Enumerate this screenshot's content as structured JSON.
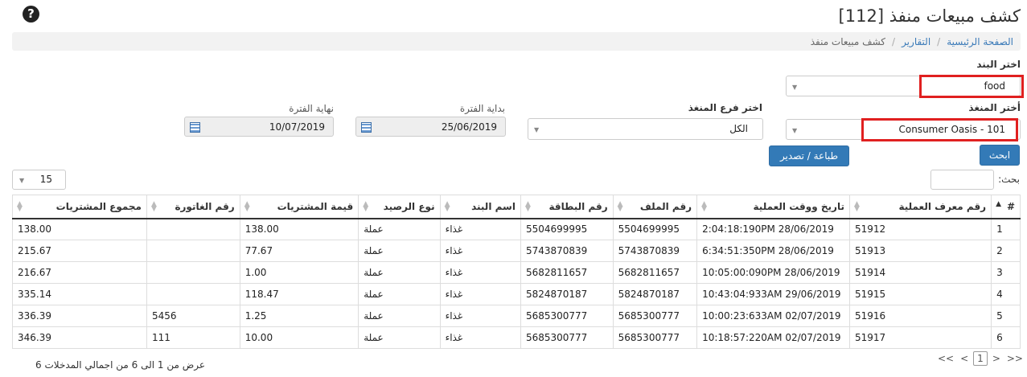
{
  "header": {
    "title": "كشف مبيعات منفذ [112]",
    "help_icon": "question-circle-icon"
  },
  "breadcrumb": {
    "home": "الصفحة الرئيسية",
    "reports": "التقارير",
    "current": "كشف مبيعات منفذ",
    "separator": "/"
  },
  "filters": {
    "item_label": "اختر البند",
    "item_value": "food",
    "outlet_label": "أختر المنغذ",
    "outlet_value": "Consumer Oasis - 101",
    "branch_label": "اختر فرع المنغذ",
    "branch_value": "الكل",
    "start_label": "بداية الفترة",
    "start_value": "25/06/2019",
    "end_label": "نهاية الفترة",
    "end_value": "10/07/2019",
    "search_button": "ابحث",
    "print_button": "طباعة / تصدير"
  },
  "table_controls": {
    "search_label": "بحث:",
    "page_size": "15"
  },
  "table": {
    "columns": [
      "#",
      "رقم معرف العملية",
      "تاريخ ووقت العملية",
      "رقم الملف",
      "رقم البطاقة",
      "اسم البند",
      "نوع الرصيد",
      "قيمة المشتريات",
      "رقم الغاتورة",
      "مجموع المشتريات"
    ],
    "rows": [
      [
        "1",
        "51912",
        "2:04:18:190PM 28/06/2019",
        "5504699995",
        "5504699995",
        "غذاء",
        "عملة",
        "138.00",
        "",
        "138.00"
      ],
      [
        "2",
        "51913",
        "6:34:51:350PM 28/06/2019",
        "5743870839",
        "5743870839",
        "غذاء",
        "عملة",
        "77.67",
        "",
        "215.67"
      ],
      [
        "3",
        "51914",
        "10:05:00:090PM 28/06/2019",
        "5682811657",
        "5682811657",
        "غذاء",
        "عملة",
        "1.00",
        "",
        "216.67"
      ],
      [
        "4",
        "51915",
        "10:43:04:933AM 29/06/2019",
        "5824870187",
        "5824870187",
        "غذاء",
        "عملة",
        "118.47",
        "",
        "335.14"
      ],
      [
        "5",
        "51916",
        "10:00:23:633AM 02/07/2019",
        "5685300777",
        "5685300777",
        "غذاء",
        "عملة",
        "1.25",
        "5456",
        "336.39"
      ],
      [
        "6",
        "51917",
        "10:18:57:220AM 02/07/2019",
        "5685300777",
        "5685300777",
        "غذاء",
        "عملة",
        "10.00",
        "111",
        "346.39"
      ]
    ]
  },
  "footer": {
    "info": "عرض من 1 الى 6 من اجمالي المدخلات 6",
    "pager_first": "<<",
    "pager_prev": "<",
    "pager_current": "1",
    "pager_next": ">",
    "pager_last": ">>"
  },
  "colors": {
    "highlight_frame": "#e02020",
    "button_blue": "#337ab7",
    "link_blue": "#3a7ab8"
  }
}
